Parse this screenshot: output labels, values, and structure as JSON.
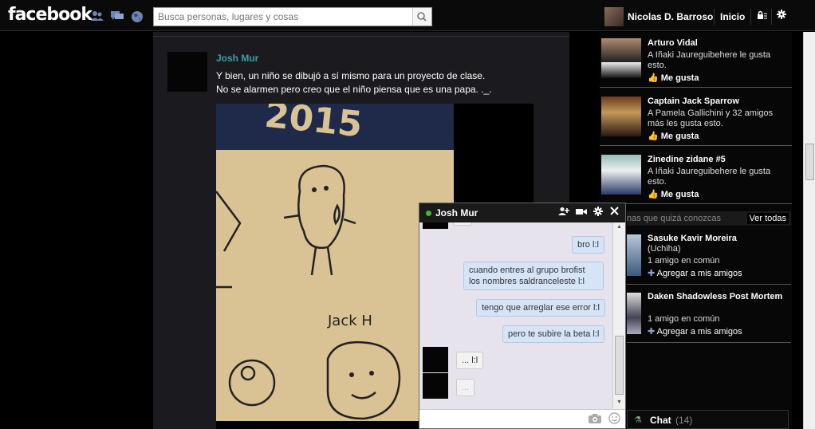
{
  "header": {
    "logo": "facebook",
    "search_placeholder": "Busca personas, lugares y cosas",
    "user_name": "Nicolas D. Barroso",
    "home_label": "Inicio"
  },
  "post": {
    "author": "Josh Mur",
    "text_line1": "Y bien, un niño se dibujó a sí mismo para un proyecto de clase.",
    "text_line2": "No se alarmen pero creo que el niño piensa que es una papa. ._.",
    "image_text_top": "2015",
    "image_text_name": "Jack H"
  },
  "suggestions": [
    {
      "name": "Arturo Vidal",
      "desc": "A Iñaki Jaureguibehere le gusta esto.",
      "like": "Me gusta"
    },
    {
      "name": "Captain Jack Sparrow",
      "desc": "A Pamela Gallichini y 32 amigos más les gusta esto.",
      "like": "Me gusta"
    },
    {
      "name": "Zinedine zidane #5",
      "desc": "A Iñaki Jaureguibehere le gusta esto.",
      "like": "Me gusta"
    }
  ],
  "pymk": {
    "title": "nas que quizá conozcas",
    "see_all": "Ver todas",
    "people": [
      {
        "name": "Sasuke Kavir Moreira",
        "sub": "(Uchiha)",
        "mutual": "1 amigo en común",
        "add": "Agregar a mis amigos"
      },
      {
        "name": "Daken Shadowless Post Mortem",
        "sub": "",
        "mutual": "1 amigo en común",
        "add": "Agregar a mis amigos"
      }
    ]
  },
  "chatbar": {
    "label": "Chat",
    "count": "(14)"
  },
  "chat": {
    "name": "Josh Mur",
    "messages": [
      {
        "from": "me",
        "text": "bro l:l"
      },
      {
        "from": "me",
        "text": "cuando entres al grupo brofist los nombres saldranceleste l:l"
      },
      {
        "from": "me",
        "text": "tengo que arreglar ese error l:l"
      },
      {
        "from": "me",
        "text": "pero te subire la beta l:l"
      },
      {
        "from": "them",
        "text": "... l:l"
      },
      {
        "from": "them",
        "text": "..."
      }
    ]
  }
}
